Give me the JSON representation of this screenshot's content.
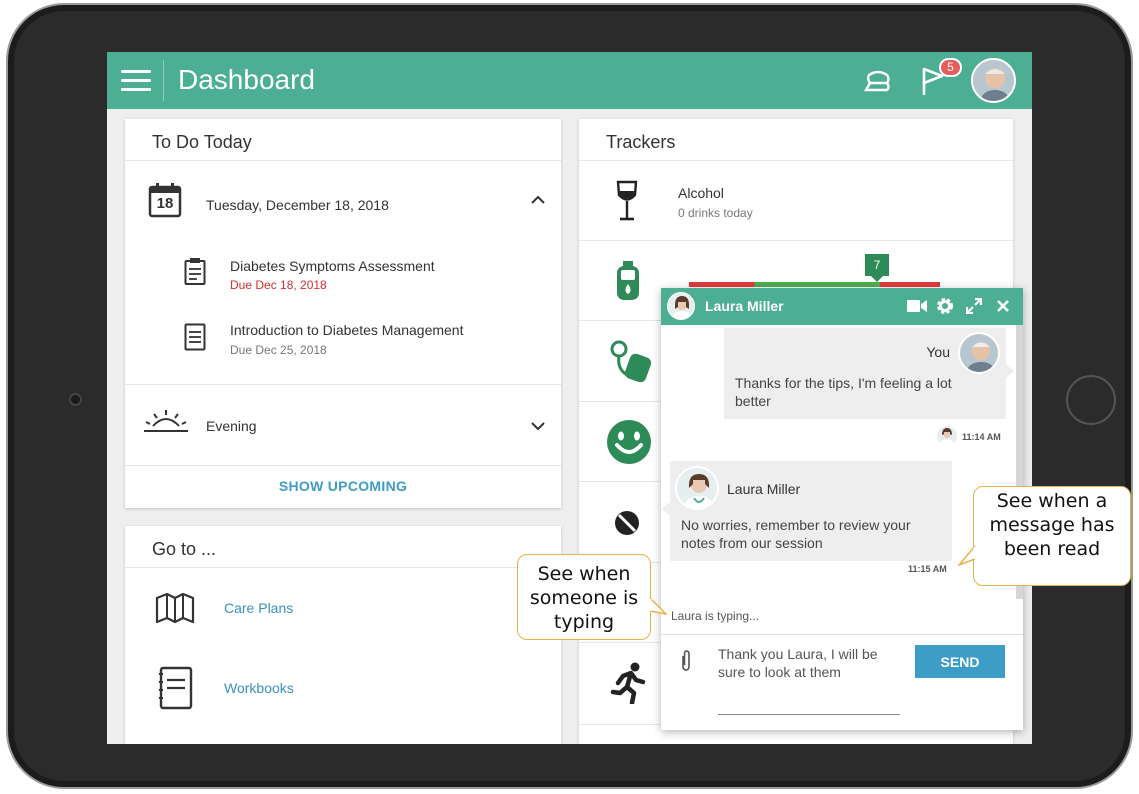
{
  "header": {
    "title": "Dashboard",
    "notification_count": "5"
  },
  "todo": {
    "title": "To Do Today",
    "calendar_day": "18",
    "date": "Tuesday, December 18, 2018",
    "tasks": [
      {
        "title": "Diabetes Symptoms Assessment",
        "due": "Due Dec 18, 2018",
        "due_color": "#d32f2f"
      },
      {
        "title": "Introduction to Diabetes Management",
        "due": "Due Dec 25, 2018",
        "due_color": "#777777"
      }
    ],
    "evening": "Evening",
    "show_upcoming": "SHOW UPCOMING"
  },
  "goto": {
    "title": "Go to ...",
    "links": [
      {
        "label": "Care Plans"
      },
      {
        "label": "Workbooks"
      }
    ]
  },
  "trackers": {
    "title": "Trackers",
    "alcohol": {
      "name": "Alcohol",
      "sub": "0 drinks today"
    },
    "glucose_marker": "7"
  },
  "chat": {
    "name": "Laura Miller",
    "you_name": "You",
    "you_message": "Thanks for the tips, I'm feeling a lot better",
    "you_time": "11:14 AM",
    "laura_name": "Laura Miller",
    "laura_message": "No worries, remember to review your notes from our session",
    "laura_time": "11:15 AM",
    "typing": "Laura is typing...",
    "input_value": "Thank you Laura, I will be sure to look at them",
    "send_label": "SEND"
  },
  "callouts": {
    "typing": "See when someone is typing",
    "read": "See when a message has been read"
  },
  "colors": {
    "accent": "#4caf94",
    "link": "#3d8fc2",
    "button": "#3d9dc7",
    "callout_border": "#e7b24a"
  }
}
